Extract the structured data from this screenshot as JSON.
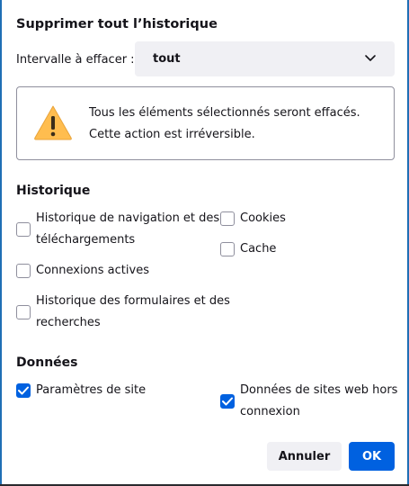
{
  "dialog": {
    "title": "Supprimer tout l’historique",
    "range_label": "Intervalle à effacer :",
    "range_value": "tout",
    "warning_line1": "Tous les éléments sélectionnés seront effacés.",
    "warning_line2": "Cette action est irréversible."
  },
  "history": {
    "title": "Historique",
    "options": [
      {
        "line1": "Historique de navigation et des",
        "line2": "téléchargements",
        "checked": false
      },
      {
        "line1": "Connexions actives",
        "checked": false
      },
      {
        "line1": "Historique des formulaires et des",
        "line2": "recherches",
        "checked": false
      },
      {
        "line1": "Cookies",
        "checked": false
      },
      {
        "line1": "Cache",
        "checked": false
      }
    ]
  },
  "data_section": {
    "title": "Données",
    "options": [
      {
        "line1": "Paramètres de site",
        "checked": true
      },
      {
        "line1": "Données de sites web hors",
        "line2": "connexion",
        "checked": true
      }
    ]
  },
  "buttons": {
    "cancel": "Annuler",
    "ok": "OK"
  },
  "icons": {
    "range_dropdown": "chevron-down-icon",
    "warning": "warning-triangle-icon",
    "check": "checkmark-icon"
  },
  "colors": {
    "accent": "#0061e0",
    "warning": "#ffbd4f",
    "secondary_button": "#f0f0f4"
  }
}
